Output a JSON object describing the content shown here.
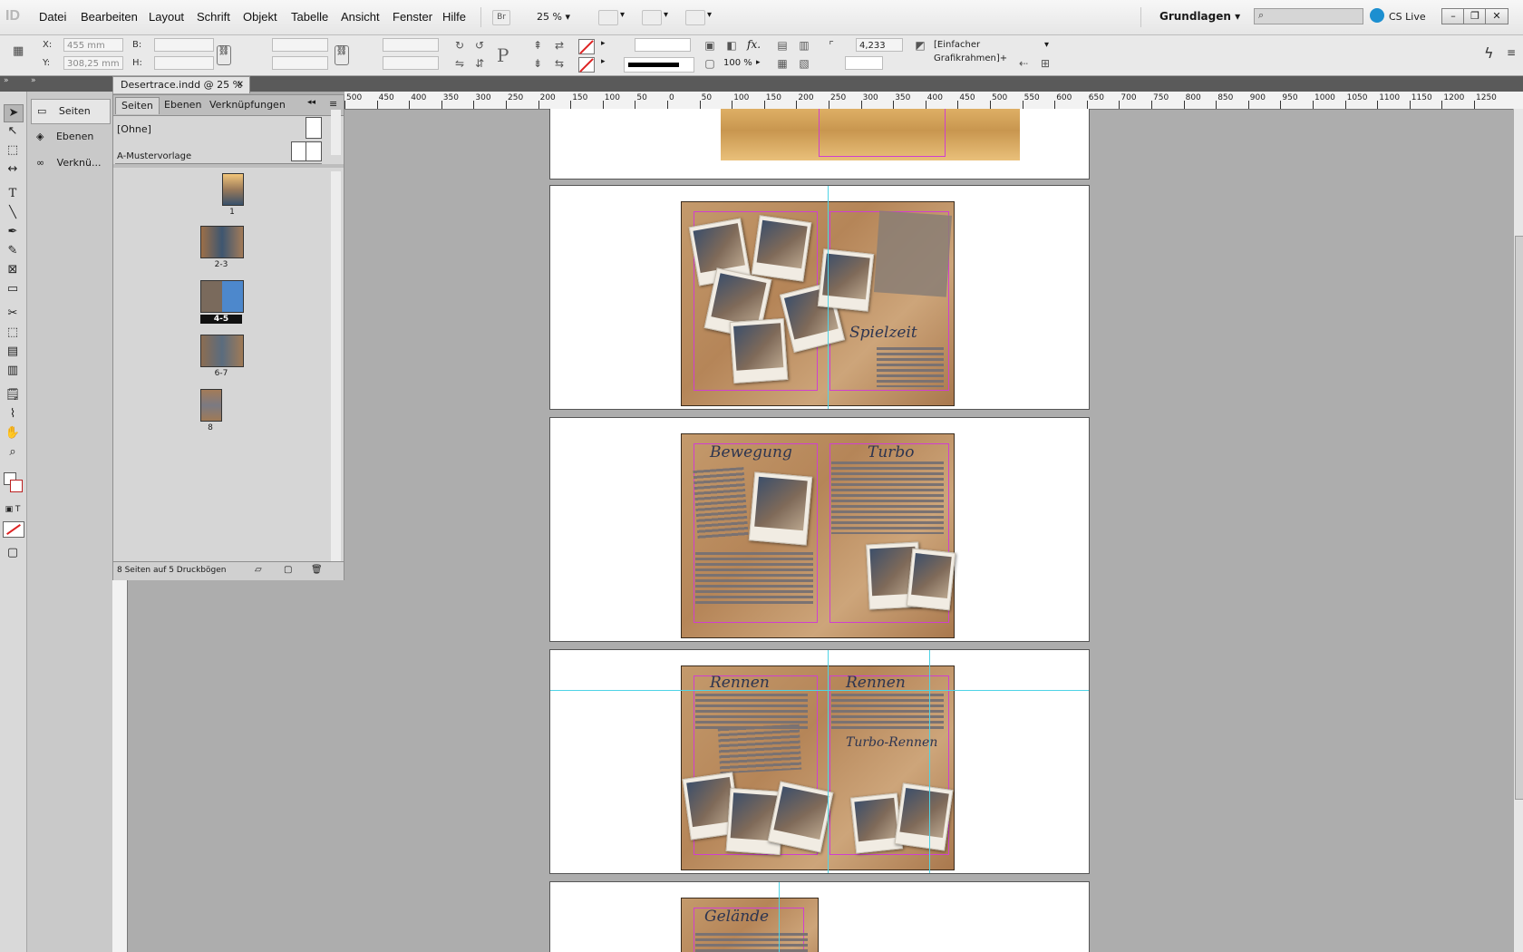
{
  "menubar": {
    "app_logo": "ID",
    "items": [
      "Datei",
      "Bearbeiten",
      "Layout",
      "Schrift",
      "Objekt",
      "Tabelle",
      "Ansicht",
      "Fenster",
      "Hilfe"
    ],
    "bridge": "Br",
    "zoom": "25 %",
    "workspace": "Grundlagen",
    "cs_live": "CS Live"
  },
  "control": {
    "x_label": "X:",
    "x_value": "455 mm",
    "y_label": "Y:",
    "y_value": "308,25 mm",
    "w_label": "B:",
    "h_label": "H:",
    "stroke_weight": "4,233 mm",
    "scale_percent": "100 %",
    "object_style": "[Einfacher Grafikrahmen]+"
  },
  "document_tab": {
    "title": "Desertrace.indd @ 25 %"
  },
  "dock": {
    "items": [
      "Seiten",
      "Ebenen",
      "Verknü..."
    ]
  },
  "pages_panel": {
    "tabs": [
      "Seiten",
      "Ebenen",
      "Verknüpfungen"
    ],
    "masters": [
      "[Ohne]",
      "A-Mustervorlage"
    ],
    "page_labels": [
      "1",
      "2-3",
      "4-5",
      "6-7",
      "8"
    ],
    "footer": "8 Seiten auf 5 Druckbögen"
  },
  "ruler": {
    "labels": [
      "500",
      "450",
      "400",
      "350",
      "300",
      "250",
      "200",
      "150",
      "100",
      "50",
      "0",
      "50",
      "100",
      "150",
      "200",
      "250",
      "300",
      "350",
      "400",
      "450",
      "500",
      "550",
      "600",
      "650",
      "700",
      "750",
      "800",
      "850",
      "900",
      "950",
      "1000",
      "1050",
      "1100",
      "1150",
      "1200",
      "1250"
    ]
  },
  "spreads": {
    "titles": [
      "Spielzeit",
      "Bewegung",
      "Turbo",
      "Rennen",
      "Rennen",
      "Turbo-Rennen",
      "Gelände"
    ]
  }
}
